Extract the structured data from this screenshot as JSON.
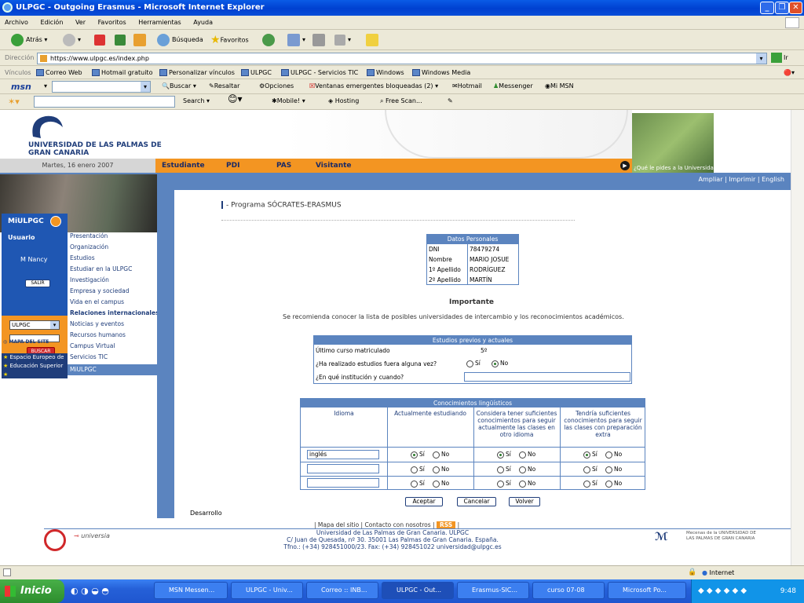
{
  "window": {
    "title": "ULPGC - Outgoing Erasmus - Microsoft Internet Explorer"
  },
  "menu": [
    "Archivo",
    "Edición",
    "Ver",
    "Favoritos",
    "Herramientas",
    "Ayuda"
  ],
  "toolbar": {
    "back": "Atrás",
    "search": "Búsqueda",
    "favorites": "Favoritos"
  },
  "address": {
    "label": "Dirección",
    "url": "https://www.ulpgc.es/index.php",
    "go": "Ir"
  },
  "links": {
    "label": "Vínculos",
    "items": [
      "Correo Web",
      "Hotmail gratuito",
      "Personalizar vínculos",
      "ULPGC",
      "ULPGC - Servicios TIC",
      "Windows",
      "Windows Media"
    ]
  },
  "msn": {
    "logo": "msn",
    "items": [
      "Buscar",
      "Resaltar",
      "Opciones",
      "Ventanas emergentes bloqueadas (2)",
      "Hotmail",
      "Messenger",
      "Mi MSN"
    ]
  },
  "searchbar": {
    "items": [
      "Search",
      "Mobile!",
      "Hosting",
      "Free Scan..."
    ]
  },
  "site": {
    "uni_name": "UNIVERSIDAD DE LAS PALMAS DE GRAN CANARIA",
    "date": "Martes, 16 enero 2007",
    "nav": [
      "Estudiante",
      "PDI",
      "PAS",
      "Visitante"
    ],
    "question": "¿Qué le pides a la Universidad?",
    "tools": "Ampliar | Imprimir | English",
    "miulpgc": "MiULPGC",
    "user_label": "Usuario",
    "user_name": "M Nancy",
    "salir": "SALIR",
    "select": "ULPGC",
    "buscar": "BUSCAR",
    "mapa": "MAPA DEL SITE",
    "espacio1": "Espacio Europeo de",
    "espacio2": "Educación Superior",
    "left_menu": [
      "Presentación",
      "Organización",
      "Estudios",
      "Estudiar en la ULPGC",
      "Investigación",
      "Empresa y sociedad",
      "Vida en el campus",
      "Relaciones internacionales",
      "Noticias y eventos",
      "Recursos humanos",
      "Campus Virtual",
      "Servicios TIC",
      "MiULPGC"
    ]
  },
  "program": {
    "title": "Programa SÓCRATES-ERASMUS"
  },
  "personal": {
    "header": "Datos Personales",
    "rows": [
      [
        "DNI",
        "78479274"
      ],
      [
        "Nombre",
        "MARIO JOSUE"
      ],
      [
        "1º Apellido",
        "RODRÍGUEZ"
      ],
      [
        "2º Apellido",
        "MARTÍN"
      ]
    ]
  },
  "important": {
    "title": "Importante",
    "text": "Se recomienda conocer la lista de posibles universidades de intercambio y los reconocimientos académicos."
  },
  "studies": {
    "header": "Estudios previos y actuales",
    "last_course_label": "Último curso matriculado",
    "last_course_value": "5º",
    "abroad_question": "¿Ha realizado estudios fuera alguna vez?",
    "yes": "Sí",
    "no": "No",
    "institution_question": "¿En qué institución y cuando?"
  },
  "languages": {
    "header": "Conocimientos lingüísticos",
    "columns": [
      "Idioma",
      "Actualmente estudiando",
      "Considera tener suficientes conocimientos para seguir actualmente las clases en otro idioma",
      "Tendría suficientes conocimientos para seguir las clases con preparación extra"
    ],
    "rows": [
      {
        "language": "inglés"
      },
      {
        "language": ""
      },
      {
        "language": ""
      }
    ],
    "yes": "Sí",
    "no": "No"
  },
  "buttons": {
    "accept": "Aceptar",
    "cancel": "Cancelar",
    "back": "Volver"
  },
  "desarrollo": "Desarrollo",
  "footer": {
    "links": "| Mapa del sitio | Contacto con nosotros |",
    "rss": "RSS",
    "line1": "Universidad de Las Palmas de Gran Canaria. ULPGC",
    "line2": "C/ Juan de Quesada, nº 30. 35001 Las Palmas de Gran Canaria. España.",
    "line3": "Tfno.: (+34) 928451000/23. Fax: (+34) 928451022 universidad@ulpgc.es",
    "universia": "universia",
    "mecenas": "Mecenas de la UNIVERSIDAD DE LAS PALMAS DE GRAN CANARIA"
  },
  "status": {
    "zone": "Internet"
  },
  "taskbar": {
    "start": "Inicio",
    "tasks": [
      "MSN Messen...",
      "ULPGC - Univ...",
      "Correo :: INB...",
      "ULPGC - Out...",
      "Erasmus-SIC...",
      "curso 07-08",
      "Microsoft Po..."
    ],
    "clock": "9:48"
  }
}
